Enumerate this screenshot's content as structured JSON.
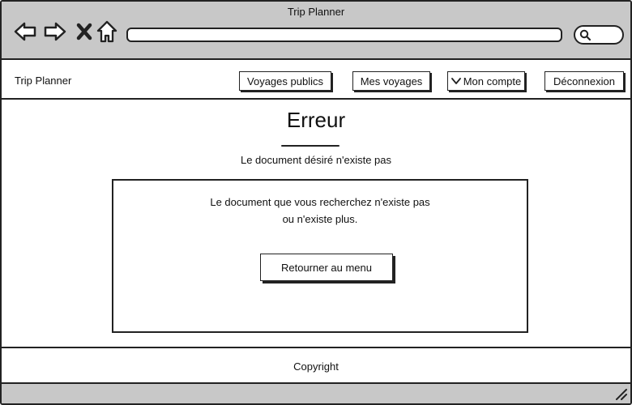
{
  "browser": {
    "title": "Trip Planner",
    "address_value": "",
    "icons": {
      "back": "back-arrow-icon",
      "forward": "forward-arrow-icon",
      "stop": "close-icon",
      "home": "home-icon",
      "search": "search-icon",
      "resize": "resize-grip-icon"
    }
  },
  "header": {
    "brand": "Trip Planner",
    "nav": {
      "public_trips": "Voyages publics",
      "my_trips": "Mes voyages",
      "account": "Mon compte",
      "logout": "Déconnexion"
    }
  },
  "main": {
    "title": "Erreur",
    "subtitle": "Le document désiré n'existe pas",
    "message_line1": "Le document que vous recherchez n'existe pas",
    "message_line2": "ou n'existe plus.",
    "back_button": "Retourner au menu"
  },
  "footer": {
    "text": "Copyright"
  }
}
